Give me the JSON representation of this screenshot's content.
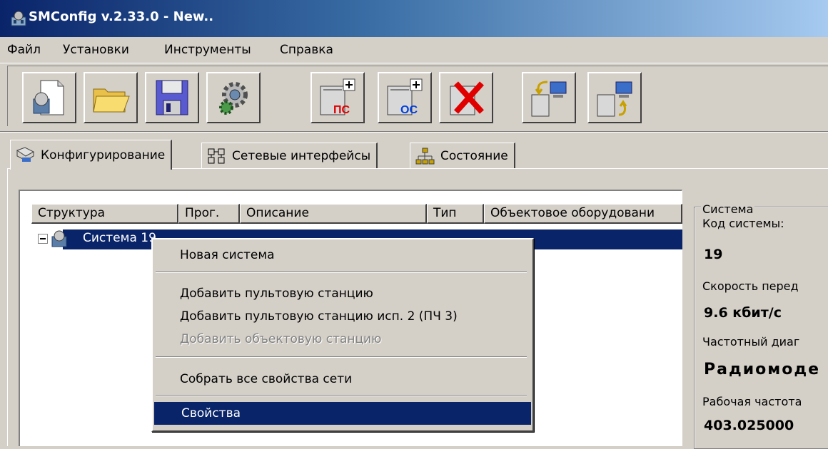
{
  "window": {
    "title": "SMConfig v.2.33.0 - New..",
    "icon": "app-icon"
  },
  "menu": [
    "Файл",
    "Установки",
    "Инструменты",
    "Справка"
  ],
  "toolbar": {
    "buttons": [
      {
        "name": "new-config-button",
        "icon": "new-document-icon"
      },
      {
        "name": "open-button",
        "icon": "folder-icon"
      },
      {
        "name": "save-button",
        "icon": "floppy-icon"
      },
      {
        "name": "settings-button",
        "icon": "gear-icon"
      },
      {
        "name": "add-ps-button",
        "icon": "add-station-ps-icon",
        "badge": "ПС"
      },
      {
        "name": "add-os-button",
        "icon": "add-station-os-icon",
        "badge": "ОС"
      },
      {
        "name": "delete-button",
        "icon": "delete-icon"
      },
      {
        "name": "read-config-button",
        "icon": "download-icon"
      },
      {
        "name": "write-config-button",
        "icon": "upload-icon"
      }
    ]
  },
  "tabs": [
    {
      "label": "Конфигурирование",
      "icon": "configure-icon",
      "active": true
    },
    {
      "label": "Сетевые интерфейсы",
      "icon": "network-interfaces-icon",
      "active": false
    },
    {
      "label": "Состояние",
      "icon": "status-tree-icon",
      "active": false
    }
  ],
  "list": {
    "columns": [
      "Структура",
      "Прог.",
      "Описание",
      "Тип",
      "Объектовое оборудовани"
    ],
    "tree": {
      "label": "Система 19",
      "expanded": true,
      "selected": true
    }
  },
  "context_menu": {
    "items": [
      {
        "label": "Новая система",
        "enabled": true
      },
      {
        "separator": true
      },
      {
        "label": "Добавить пультовую станцию",
        "enabled": true
      },
      {
        "label": "Добавить пультовую станцию исп. 2 (ПЧ 3)",
        "enabled": true
      },
      {
        "label": "Добавить объектовую станцию",
        "enabled": false
      },
      {
        "separator": true
      },
      {
        "label": "Собрать все свойства сети",
        "enabled": true
      },
      {
        "separator": true
      },
      {
        "label": "Свойства",
        "enabled": true,
        "highlighted": true
      }
    ]
  },
  "system_panel": {
    "title": "Система",
    "fields": [
      {
        "label": "Код системы:",
        "value": "19"
      },
      {
        "label": "Скорость перед",
        "value": "9.6 кбит/с"
      },
      {
        "label": "Частотный диаг",
        "value": "Радиомоде"
      },
      {
        "label": "Рабочая частота",
        "value": "403.025000"
      }
    ]
  },
  "colors": {
    "face": "#d4d0c8",
    "selection": "#0a246a",
    "title_start": "#0a246a",
    "title_end": "#a6caf0"
  }
}
